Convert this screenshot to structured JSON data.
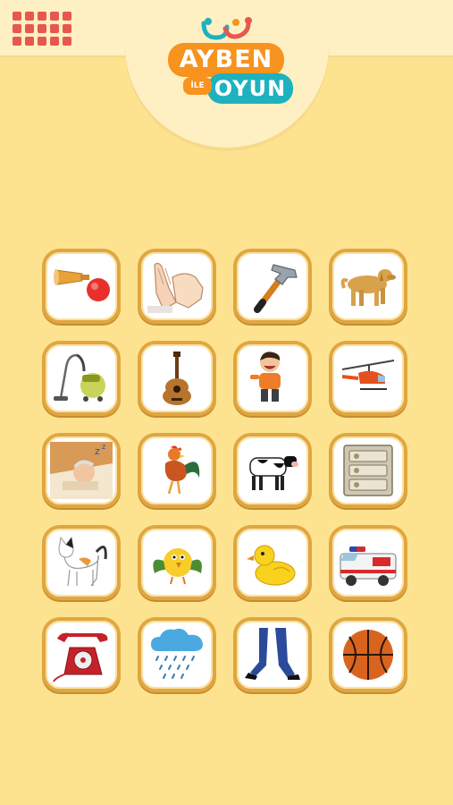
{
  "app": {
    "logo_top": "AYBEN",
    "logo_middle": "İLE",
    "logo_bottom": "OYUN"
  },
  "colors": {
    "background": "#fde38f",
    "header": "#fef0c2",
    "tile_border": "#e0a640",
    "menu": "#e8574f",
    "logo_orange": "#f7931e",
    "logo_teal": "#1fb1bf"
  },
  "grid": {
    "tiles": [
      {
        "icon": "horn-icon"
      },
      {
        "icon": "clapping-hands-icon"
      },
      {
        "icon": "hammer-icon"
      },
      {
        "icon": "dog-icon"
      },
      {
        "icon": "vacuum-cleaner-icon"
      },
      {
        "icon": "guitar-icon"
      },
      {
        "icon": "laughing-boy-icon"
      },
      {
        "icon": "helicopter-icon"
      },
      {
        "icon": "snoring-man-icon"
      },
      {
        "icon": "rooster-icon"
      },
      {
        "icon": "cow-icon"
      },
      {
        "icon": "doorbell-panel-icon"
      },
      {
        "icon": "cat-icon"
      },
      {
        "icon": "bird-icon"
      },
      {
        "icon": "duck-icon"
      },
      {
        "icon": "ambulance-icon"
      },
      {
        "icon": "telephone-icon"
      },
      {
        "icon": "rain-cloud-icon"
      },
      {
        "icon": "walking-legs-icon"
      },
      {
        "icon": "basketball-icon"
      }
    ]
  }
}
